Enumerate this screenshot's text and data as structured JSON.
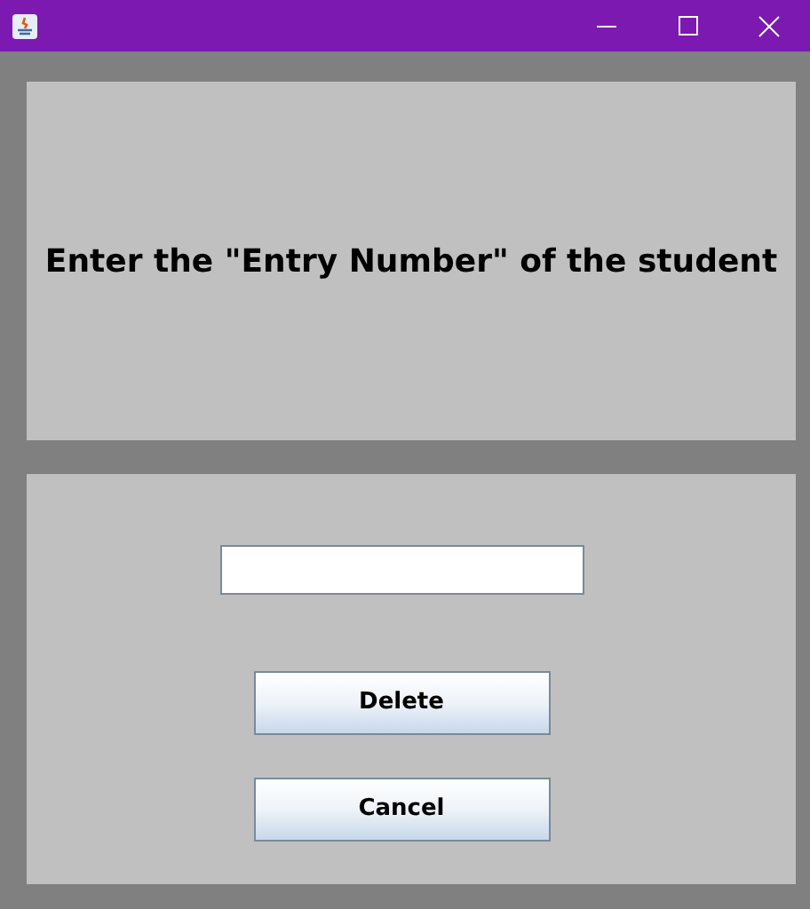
{
  "prompt": "Enter the \"Entry Number\" of the student",
  "buttons": [
    {
      "label": "Delete"
    },
    {
      "label": "Cancel"
    }
  ]
}
